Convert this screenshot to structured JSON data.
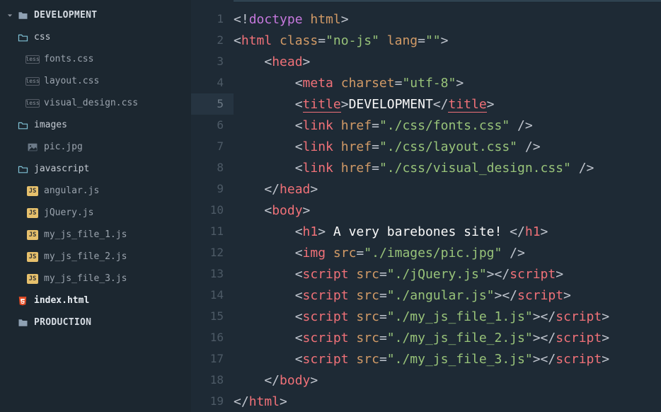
{
  "sidebar": {
    "root1": "DEVELOPMENT",
    "folder_css": "css",
    "file_fonts": "fonts.css",
    "file_layout": "layout.css",
    "file_visual": "visual_design.css",
    "folder_images": "images",
    "file_pic": "pic.jpg",
    "folder_js": "javascript",
    "file_angular": "angular.js",
    "file_jquery": "jQuery.js",
    "file_js1": "my_js_file_1.js",
    "file_js2": "my_js_file_2.js",
    "file_js3": "my_js_file_3.js",
    "file_index": "index.html",
    "root2": "PRODUCTION",
    "badge_less": "less",
    "badge_js": "JS"
  },
  "gutter": {
    "l1": "1",
    "l2": "2",
    "l3": "3",
    "l4": "4",
    "l5": "5",
    "l6": "6",
    "l7": "7",
    "l8": "8",
    "l9": "9",
    "l10": "10",
    "l11": "11",
    "l12": "12",
    "l13": "13",
    "l14": "14",
    "l15": "15",
    "l16": "16",
    "l17": "17",
    "l18": "18",
    "l19": "19"
  },
  "code": {
    "l1": {
      "t1": "<!",
      "t2": "doctype",
      "t3": " html",
      "t4": ">"
    },
    "l2": {
      "t1": "<",
      "t2": "html",
      "t3": " class",
      "t4": "=",
      "t5": "\"no-js\"",
      "t6": " lang",
      "t7": "=",
      "t8": "\"\"",
      "t9": ">"
    },
    "l3": {
      "t1": "    <",
      "t2": "head",
      "t3": ">"
    },
    "l4": {
      "t1": "        <",
      "t2": "meta",
      "t3": " charset",
      "t4": "=",
      "t5": "\"utf-8\"",
      "t6": ">"
    },
    "l5": {
      "t1": "        <",
      "t2": "title",
      "t3": ">",
      "t4": "DEVELOPMENT",
      "t5": "</",
      "t6": "title",
      "t7": ">"
    },
    "l6": {
      "t1": "        <",
      "t2": "link",
      "t3": " href",
      "t4": "=",
      "t5": "\"./css/fonts.css\"",
      "t6": " />"
    },
    "l7": {
      "t1": "        <",
      "t2": "link",
      "t3": " href",
      "t4": "=",
      "t5": "\"./css/layout.css\"",
      "t6": " />"
    },
    "l8": {
      "t1": "        <",
      "t2": "link",
      "t3": " href",
      "t4": "=",
      "t5": "\"./css/visual_design.css\"",
      "t6": " />"
    },
    "l9": {
      "t1": "    </",
      "t2": "head",
      "t3": ">"
    },
    "l10": {
      "t1": "    <",
      "t2": "body",
      "t3": ">"
    },
    "l11": {
      "t1": "        <",
      "t2": "h1",
      "t3": ">",
      "t4": " A very barebones site! ",
      "t5": "</",
      "t6": "h1",
      "t7": ">"
    },
    "l12": {
      "t1": "        <",
      "t2": "img",
      "t3": " src",
      "t4": "=",
      "t5": "\"./images/pic.jpg\"",
      "t6": " />"
    },
    "l13": {
      "t1": "        <",
      "t2": "script",
      "t3": " src",
      "t4": "=",
      "t5": "\"./jQuery.js\"",
      "t6": "></",
      "t7": "script",
      "t8": ">"
    },
    "l14": {
      "t1": "        <",
      "t2": "script",
      "t3": " src",
      "t4": "=",
      "t5": "\"./angular.js\"",
      "t6": "></",
      "t7": "script",
      "t8": ">"
    },
    "l15": {
      "t1": "        <",
      "t2": "script",
      "t3": " src",
      "t4": "=",
      "t5": "\"./my_js_file_1.js\"",
      "t6": "></",
      "t7": "script",
      "t8": ">"
    },
    "l16": {
      "t1": "        <",
      "t2": "script",
      "t3": " src",
      "t4": "=",
      "t5": "\"./my_js_file_2.js\"",
      "t6": "></",
      "t7": "script",
      "t8": ">"
    },
    "l17": {
      "t1": "        <",
      "t2": "script",
      "t3": " src",
      "t4": "=",
      "t5": "\"./my_js_file_3.js\"",
      "t6": "></",
      "t7": "script",
      "t8": ">"
    },
    "l18": {
      "t1": "    </",
      "t2": "body",
      "t3": ">"
    },
    "l19": {
      "t1": "</",
      "t2": "html",
      "t3": ">"
    }
  }
}
